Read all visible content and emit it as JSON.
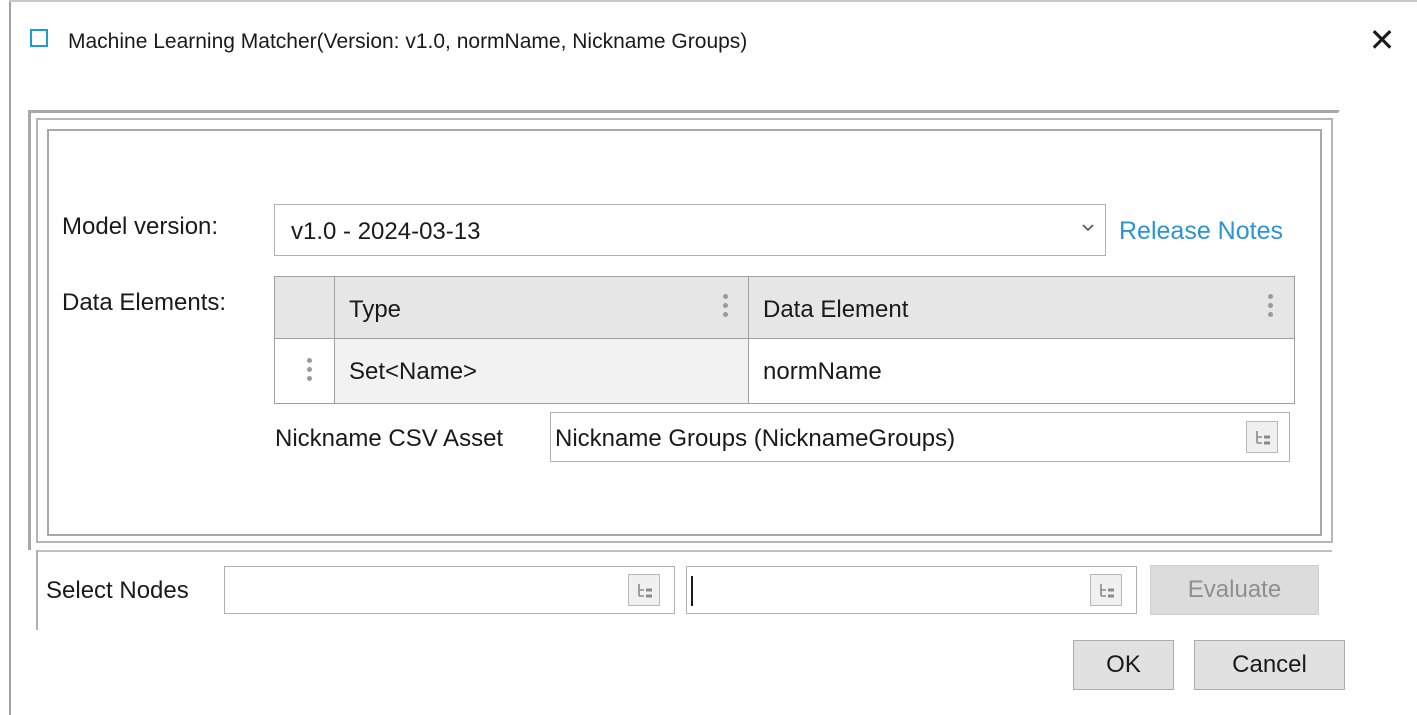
{
  "window": {
    "title": "Machine Learning Matcher(Version: v1.0, normName, Nickname Groups)",
    "close_symbol": "✕"
  },
  "form": {
    "model_version_label": "Model version:",
    "model_version_value": "v1.0 - 2024-03-13",
    "release_notes_link": "Release Notes",
    "data_elements_label": "Data Elements:",
    "table": {
      "columns": [
        "Type",
        "Data Element"
      ],
      "rows": [
        {
          "type": "Set<Name>",
          "data_element": "normName"
        }
      ]
    },
    "nickname_label": "Nickname CSV Asset",
    "nickname_value": "Nickname Groups (NicknameGroups)"
  },
  "bottom": {
    "select_nodes_label": "Select Nodes",
    "node_field_1": "",
    "node_field_2": "",
    "evaluate_label": "Evaluate",
    "ok_label": "OK",
    "cancel_label": "Cancel"
  },
  "colors": {
    "link": "#2a94d6",
    "icon_accent": "#1e9ad6"
  },
  "icons": [
    "app-window-icon",
    "close-icon",
    "chevron-down-icon",
    "kebab-icon",
    "tree-browse-icon"
  ]
}
